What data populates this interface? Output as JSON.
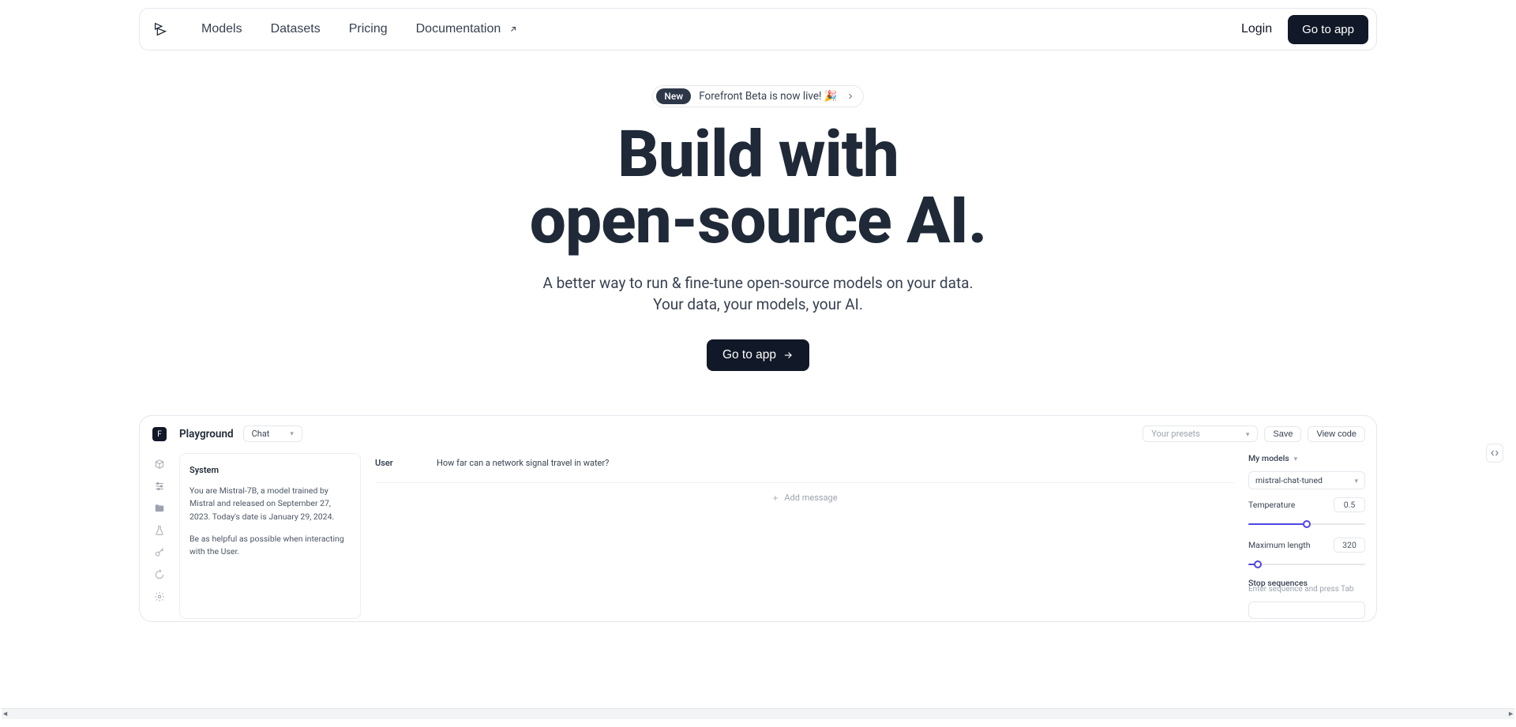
{
  "nav": {
    "items": [
      "Models",
      "Datasets",
      "Pricing"
    ],
    "docs_label": "Documentation",
    "login_label": "Login",
    "go_to_app_label": "Go to app"
  },
  "announce": {
    "badge": "New",
    "text": "Forefront Beta is now live! 🎉"
  },
  "hero": {
    "title_line1": "Build with",
    "title_line2": "open-source AI.",
    "sub_line1": "A better way to run & fine-tune open-source models on your data.",
    "sub_line2": "Your data, your models, your AI.",
    "cta": "Go to app"
  },
  "playground": {
    "title": "Playground",
    "mode": "Chat",
    "presets_placeholder": "Your presets",
    "save_label": "Save",
    "view_code_label": "View code",
    "system_title": "System",
    "system_body_p1": "You are Mistral-7B, a model trained by Mistral and released on September 27, 2023. Today's date is January 29, 2024.",
    "system_body_p2": "Be as helpful as possible when interacting with the User.",
    "convo_role": "User",
    "convo_text": "How far can a network signal travel in water?",
    "add_message_label": "Add message",
    "right": {
      "my_models_label": "My models",
      "model_selected": "mistral-chat-tuned",
      "temperature_label": "Temperature",
      "temperature_value": "0.5",
      "maxlen_label": "Maximum length",
      "maxlen_value": "320",
      "stopseq_label": "Stop sequences",
      "stopseq_hint": "Enter sequence and press Tab"
    }
  }
}
